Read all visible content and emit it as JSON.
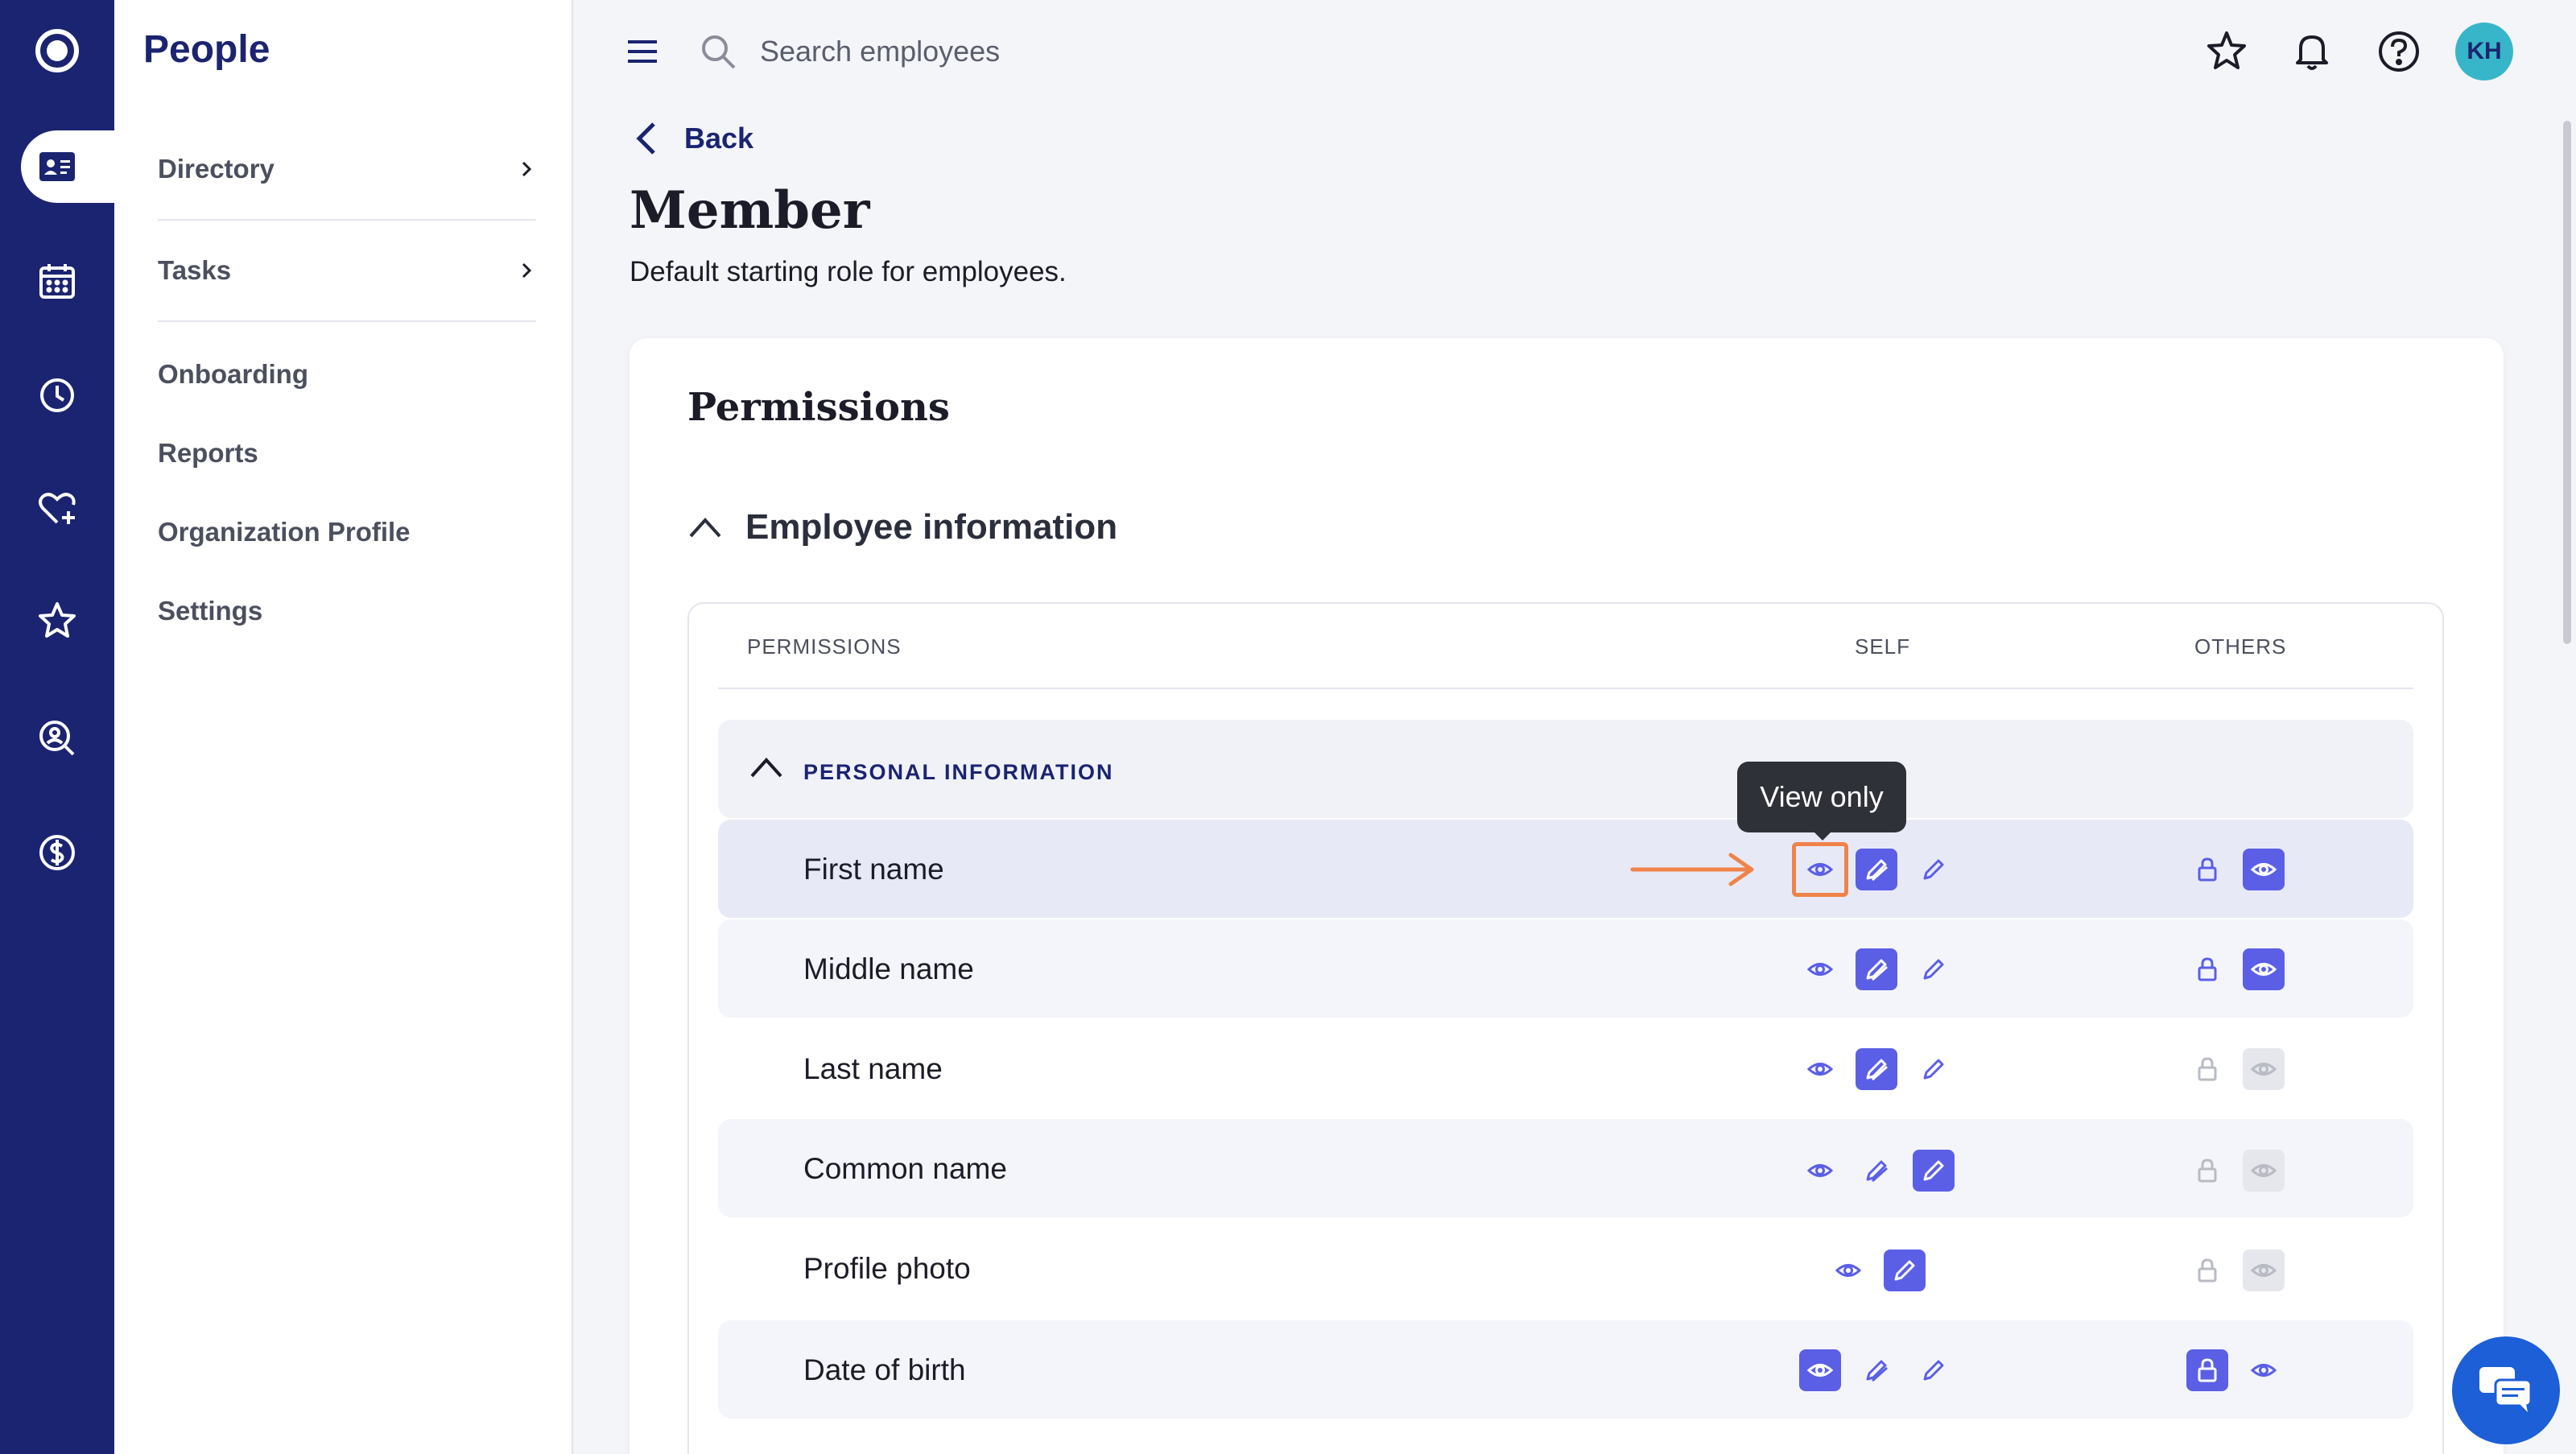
{
  "app": {
    "title": "People"
  },
  "search": {
    "placeholder": "Search employees"
  },
  "user": {
    "initials": "KH"
  },
  "sidebar": {
    "items": [
      {
        "label": "Directory",
        "has_chevron": true
      },
      {
        "label": "Tasks",
        "has_chevron": true
      },
      {
        "label": "Onboarding"
      },
      {
        "label": "Reports"
      },
      {
        "label": "Organization Profile"
      },
      {
        "label": "Settings"
      }
    ]
  },
  "rail": {
    "icons": [
      "logo-icon",
      "directory-icon",
      "calendar-icon",
      "clock-icon",
      "heart-plus-icon",
      "star-icon",
      "search-person-icon",
      "dollar-icon"
    ],
    "active": "directory-icon"
  },
  "header": {
    "back_label": "Back",
    "title": "Member",
    "description": "Default starting role for employees."
  },
  "permissions": {
    "title": "Permissions",
    "section": "Employee information",
    "columns": {
      "permissions": "PERMISSIONS",
      "self": "SELF",
      "others": "OTHERS"
    },
    "group": "PERSONAL INFORMATION",
    "rows": [
      {
        "label": "First name",
        "self": "edit-others",
        "others": "view"
      },
      {
        "label": "Middle name",
        "self": "edit-others",
        "others": "view"
      },
      {
        "label": "Last name",
        "self": "edit-others",
        "others": "view-disabled"
      },
      {
        "label": "Common name",
        "self": "edit",
        "others": "view-disabled"
      },
      {
        "label": "Profile photo",
        "self": "edit",
        "others": "view-disabled"
      },
      {
        "label": "Date of birth",
        "self": "view",
        "others": "locked"
      }
    ],
    "tooltip": "View only"
  },
  "colors": {
    "brand": "#1b2470",
    "accent": "#5b5fe6",
    "highlight": "#f0834a",
    "chat": "#1c5fd6",
    "avatar": "#38b6c9"
  }
}
